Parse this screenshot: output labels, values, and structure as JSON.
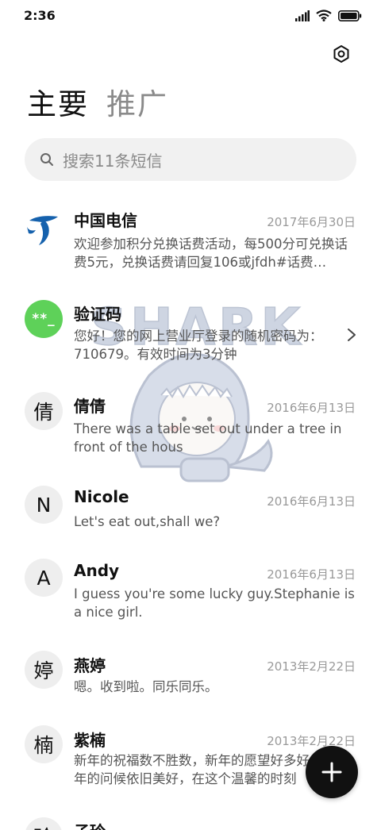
{
  "status": {
    "time": "2:36"
  },
  "header": {
    "tab_primary": "主要",
    "tab_secondary": "推广",
    "search_placeholder": "搜索11条短信"
  },
  "messages": [
    {
      "name": "中国电信",
      "date": "2017年6月30日",
      "preview": "欢迎参加积分兑换话费活动，每500分可兑换话费5元，兑换话费请回复106或jfdh#话费…",
      "avatar": "telecom-logo-icon"
    },
    {
      "name": "验证码",
      "date": "",
      "preview": "您好！您的网上营业厅登录的随机密码为：710679。有效时间为3分钟",
      "avatar_text": "**_"
    },
    {
      "name": "倩倩",
      "date": "2016年6月13日",
      "preview": "There was a table set out under a tree in front of the hous",
      "avatar_text": "倩"
    },
    {
      "name": "Nicole",
      "date": "2016年6月13日",
      "preview": "Let's eat out,shall we?",
      "avatar_text": "N"
    },
    {
      "name": "Andy",
      "date": "2016年6月13日",
      "preview": "I guess you're some lucky guy.Stephanie is a nice girl.",
      "avatar_text": "A"
    },
    {
      "name": "燕婷",
      "date": "2013年2月22日",
      "preview": "嗯。收到啦。同乐同乐。",
      "avatar_text": "婷"
    },
    {
      "name": "紫楠",
      "date": "2013年2月22日",
      "preview": "新年的祝福数不胜数，新年的愿望好多好多，新年的问候依旧美好，在这个温馨的时刻",
      "avatar_text": "楠"
    },
    {
      "name": "子玲",
      "date": "",
      "preview": "",
      "avatar_text": "玲"
    }
  ],
  "watermark": {
    "text": "SHARK"
  },
  "colors": {
    "accent_green": "#5ed159",
    "telecom_blue": "#1561ad",
    "fab": "#111111"
  }
}
